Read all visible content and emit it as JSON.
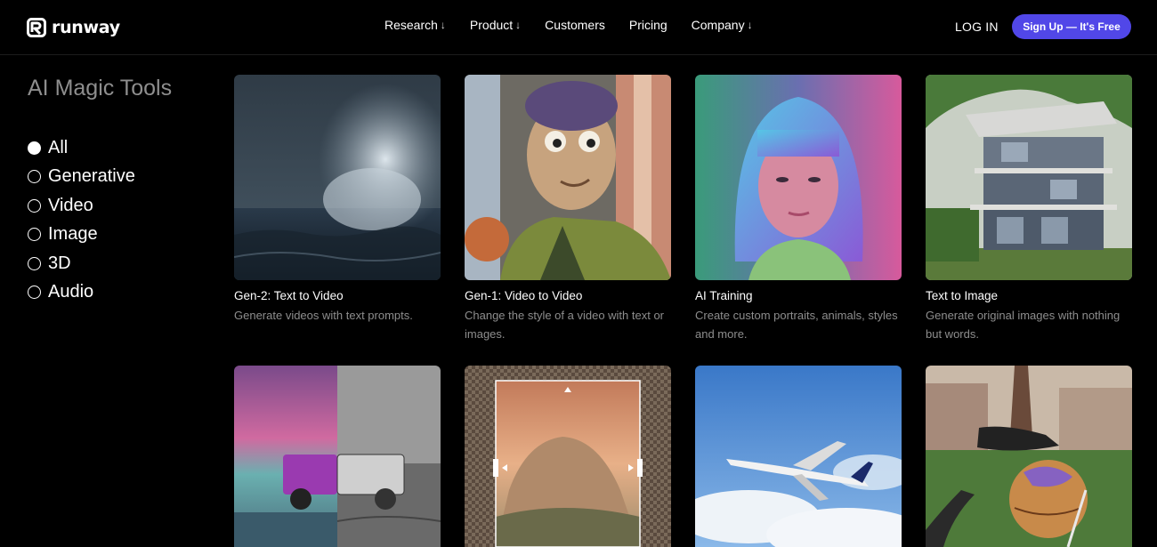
{
  "header": {
    "brand": "runway",
    "nav": [
      {
        "label": "Research",
        "arrow": "↓"
      },
      {
        "label": "Product",
        "arrow": "↓"
      },
      {
        "label": "Customers",
        "arrow": ""
      },
      {
        "label": "Pricing",
        "arrow": ""
      },
      {
        "label": "Company",
        "arrow": "↓"
      }
    ],
    "login_label": "LOG IN",
    "signup_label": "Sign Up — It's Free"
  },
  "sidebar": {
    "title": "AI Magic Tools",
    "filters": [
      {
        "label": "All",
        "selected": true
      },
      {
        "label": "Generative",
        "selected": false
      },
      {
        "label": "Video",
        "selected": false
      },
      {
        "label": "Image",
        "selected": false
      },
      {
        "label": "3D",
        "selected": false
      },
      {
        "label": "Audio",
        "selected": false
      }
    ]
  },
  "cards": [
    {
      "title": "Gen-2: Text to Video",
      "description": "Generate videos with text prompts."
    },
    {
      "title": "Gen-1: Video to Video",
      "description": "Change the style of a video with text or images."
    },
    {
      "title": "AI Training",
      "description": "Create custom portraits, animals, styles and more."
    },
    {
      "title": "Text to Image",
      "description": "Generate original images with nothing but words."
    }
  ],
  "colors": {
    "accent": "#5147e8",
    "background": "#000000",
    "muted_text": "#8d8d8d"
  }
}
